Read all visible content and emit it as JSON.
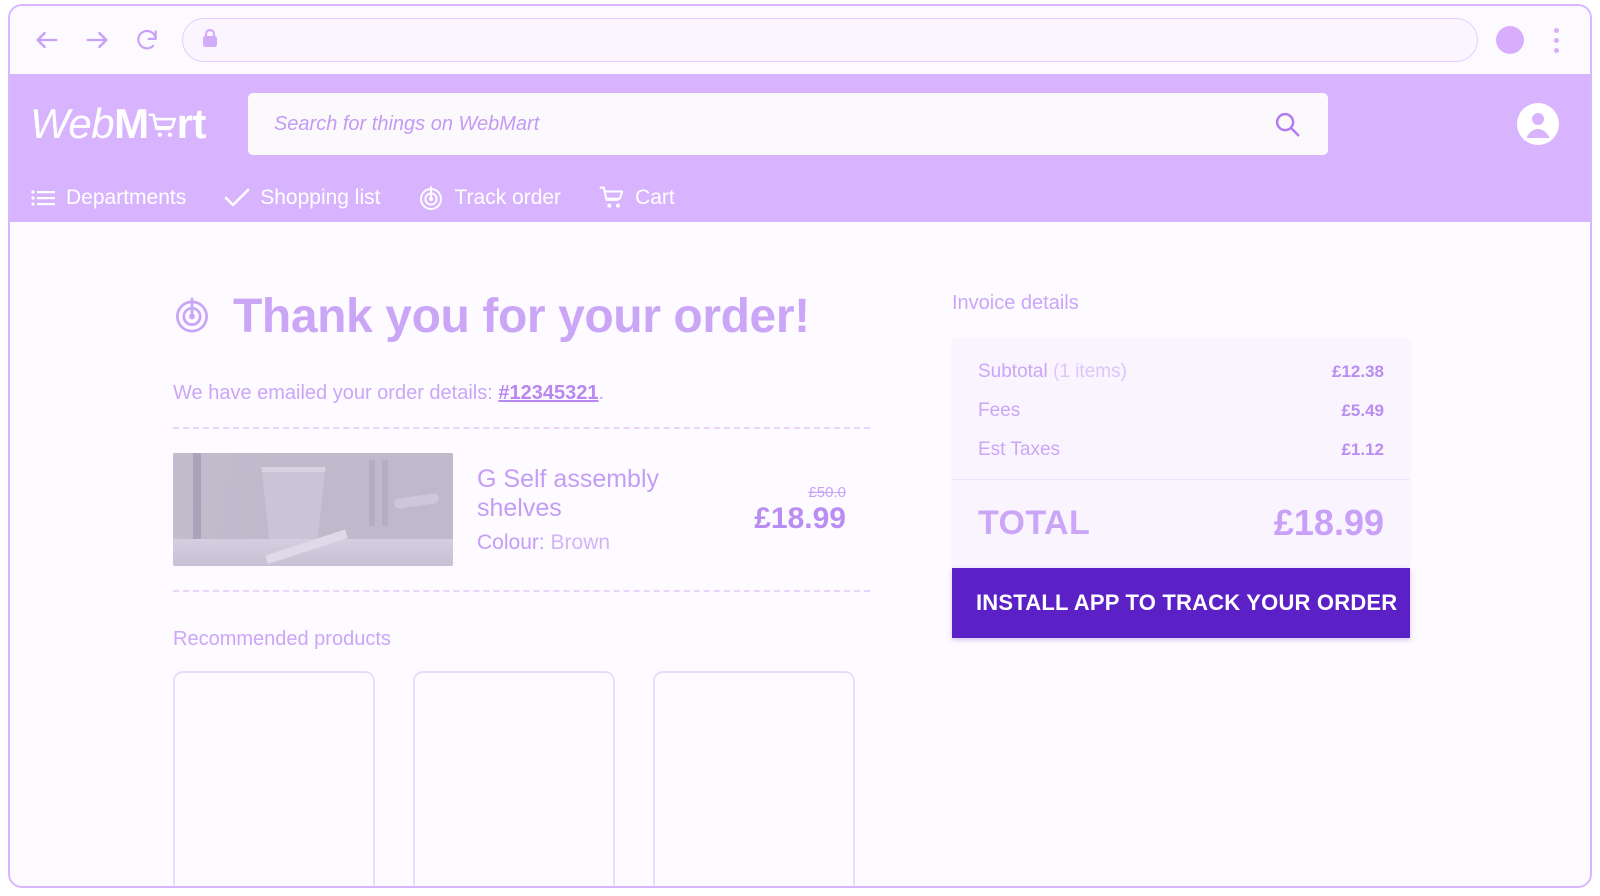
{
  "browser": {
    "back_label": "Back",
    "forward_label": "Forward",
    "reload_label": "Reload",
    "url_value": "",
    "url_placeholder": "",
    "lock_icon": "lock-icon",
    "profile_icon": "profile-circle-icon",
    "menu_icon": "kebab-menu-icon"
  },
  "header": {
    "logo": {
      "part1": "Web",
      "part2": "M",
      "cart_glyph": "shopping-cart-icon",
      "part3": "rt",
      "full_text": "WebMart"
    },
    "search": {
      "value": "",
      "placeholder": "Search for things on WebMart",
      "button_icon": "search-icon"
    },
    "account_icon": "account-circle-icon",
    "nav": [
      {
        "label": "Departments",
        "icon": "list-menu-icon"
      },
      {
        "label": "Shopping list",
        "icon": "check-icon"
      },
      {
        "label": "Track order",
        "icon": "radar-target-icon"
      },
      {
        "label": "Cart",
        "icon": "shopping-cart-icon"
      }
    ]
  },
  "main": {
    "heading": "Thank you for your order!",
    "heading_icon": "radar-target-icon",
    "emailed_prefix": "We have emailed your order details: ",
    "order_number": "#12345321",
    "emailed_suffix": ".",
    "product": {
      "title": "G Self assembly shelves",
      "colour_label": "Colour:",
      "colour_value": "Brown",
      "price_old": "£50.0",
      "price_new": "£18.99",
      "image_alt": "product-photo"
    },
    "recommended_title": "Recommended products",
    "recommended_cards": [
      "",
      "",
      ""
    ]
  },
  "invoice": {
    "title": "Invoice details",
    "rows": [
      {
        "label": "Subtotal",
        "sublabel": "(1 items)",
        "value": "£12.38"
      },
      {
        "label": "Fees",
        "sublabel": "",
        "value": "£5.49"
      },
      {
        "label": "Est Taxes",
        "sublabel": "",
        "value": "£1.12"
      }
    ],
    "total_label": "TOTAL",
    "total_value": "£18.99",
    "install_button": "INSTALL APP TO TRACK YOUR ORDER"
  },
  "colors": {
    "header_purple": "#d8b4fe",
    "accent_text": "#cba6f7",
    "cta_purple": "#5c21c6",
    "page_bg": "#fdfbff",
    "card_bg": "#faf4ff"
  }
}
